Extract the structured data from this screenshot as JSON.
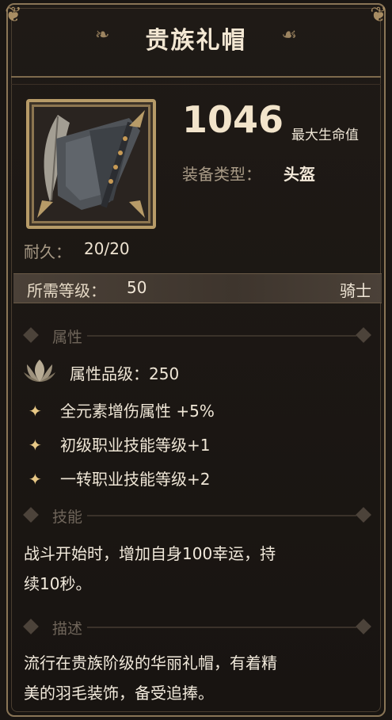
{
  "item": {
    "title": "贵族礼帽",
    "stat_value": "1046",
    "stat_name": "最大生命值",
    "type_label": "装备类型：",
    "type_value": "头盔",
    "durability_label": "耐久：",
    "durability_value": "20/20",
    "level_label": "所需等级：",
    "level_value": "50",
    "level_class": "骑士"
  },
  "sections": {
    "attributes": "属性",
    "skill": "技能",
    "description": "描述"
  },
  "attributes": {
    "grade": "属性品级：250",
    "lines": [
      "全元素增伤属性 +5%",
      "初级职业技能等级+1",
      "一转职业技能等级+2"
    ]
  },
  "skill": {
    "line1": "战斗开始时，增加自身100幸运，持",
    "line2": "续10秒。"
  },
  "description": {
    "line1": "流行在贵族阶级的华丽礼帽，有着精",
    "line2": "美的羽毛装饰，备受追捧。"
  },
  "colors": {
    "frame_gold": "#b79b68",
    "star": "#e8c886",
    "background": "#1a1613"
  },
  "icons": [
    "knight-hat-icon",
    "lotus-grade-icon",
    "star-bullet-icon",
    "diamond-divider-icon"
  ]
}
